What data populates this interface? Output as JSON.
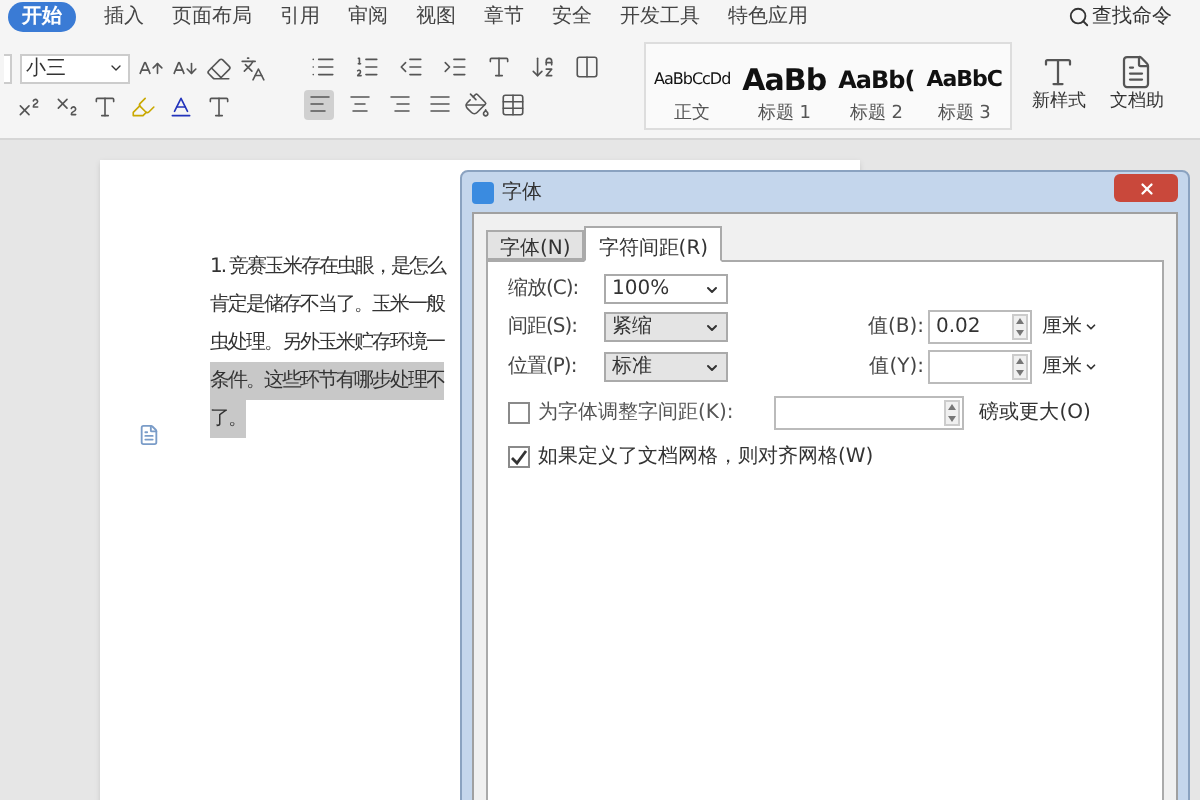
{
  "menu_tabs": [
    {
      "label": "开始",
      "selected": true
    },
    {
      "label": "插入",
      "selected": false
    },
    {
      "label": "页面布局",
      "selected": false
    },
    {
      "label": "引用",
      "selected": false
    },
    {
      "label": "审阅",
      "selected": false
    },
    {
      "label": "视图",
      "selected": false
    },
    {
      "label": "章节",
      "selected": false
    },
    {
      "label": "安全",
      "selected": false
    },
    {
      "label": "开发工具",
      "selected": false
    },
    {
      "label": "特色应用",
      "selected": false
    }
  ],
  "search": {
    "placeholder": "查找命令"
  },
  "ribbon": {
    "font_size": "小三",
    "align_buttons": [
      {
        "kind": "left",
        "selected": true
      },
      {
        "kind": "center",
        "selected": false
      },
      {
        "kind": "right",
        "selected": false
      },
      {
        "kind": "justify",
        "selected": false
      }
    ],
    "styles": [
      {
        "kind": "normal",
        "sample": "AaBbCcDd",
        "label": "正文"
      },
      {
        "kind": "heading1",
        "sample": "AaBb",
        "label": "标题 1"
      },
      {
        "kind": "heading2",
        "sample": "AaBb(",
        "label": "标题 2"
      },
      {
        "kind": "heading3",
        "sample": "AaBbC",
        "label": "标题 3"
      }
    ],
    "new_style": "新样式",
    "doc_helper": "文档助"
  },
  "document": {
    "lines": [
      {
        "text": "1. 竞赛玉米存在虫眼，是怎么",
        "selected": false
      },
      {
        "text": "肯定是储存不当了。玉米一般",
        "selected": false
      },
      {
        "text": "虫处理。另外玉米贮存环境一",
        "selected": false
      },
      {
        "text": "条件。这些环节有哪步处理不",
        "selected": true
      },
      {
        "text": "了。",
        "selected": true
      }
    ]
  },
  "dialog": {
    "title": "字体",
    "tabs": [
      {
        "label": "字体(N)",
        "selected": false
      },
      {
        "label": "字符间距(R)",
        "selected": true
      }
    ],
    "scale": {
      "label": "缩放(C):",
      "value": "100%"
    },
    "spacing": {
      "label": "间距(S):",
      "value": "紧缩",
      "amount_label": "值(B):",
      "amount": "0.02",
      "unit": "厘米"
    },
    "position": {
      "label": "位置(P):",
      "value": "标准",
      "amount_label": "值(Y):",
      "unit": "厘米"
    },
    "kerning": {
      "label": "为字体调整字间距(K):",
      "checked": false,
      "suffix": "磅或更大(O)"
    },
    "snap_grid": {
      "label": "如果定义了文档网格，则对齐网格(W)",
      "checked": true
    }
  }
}
